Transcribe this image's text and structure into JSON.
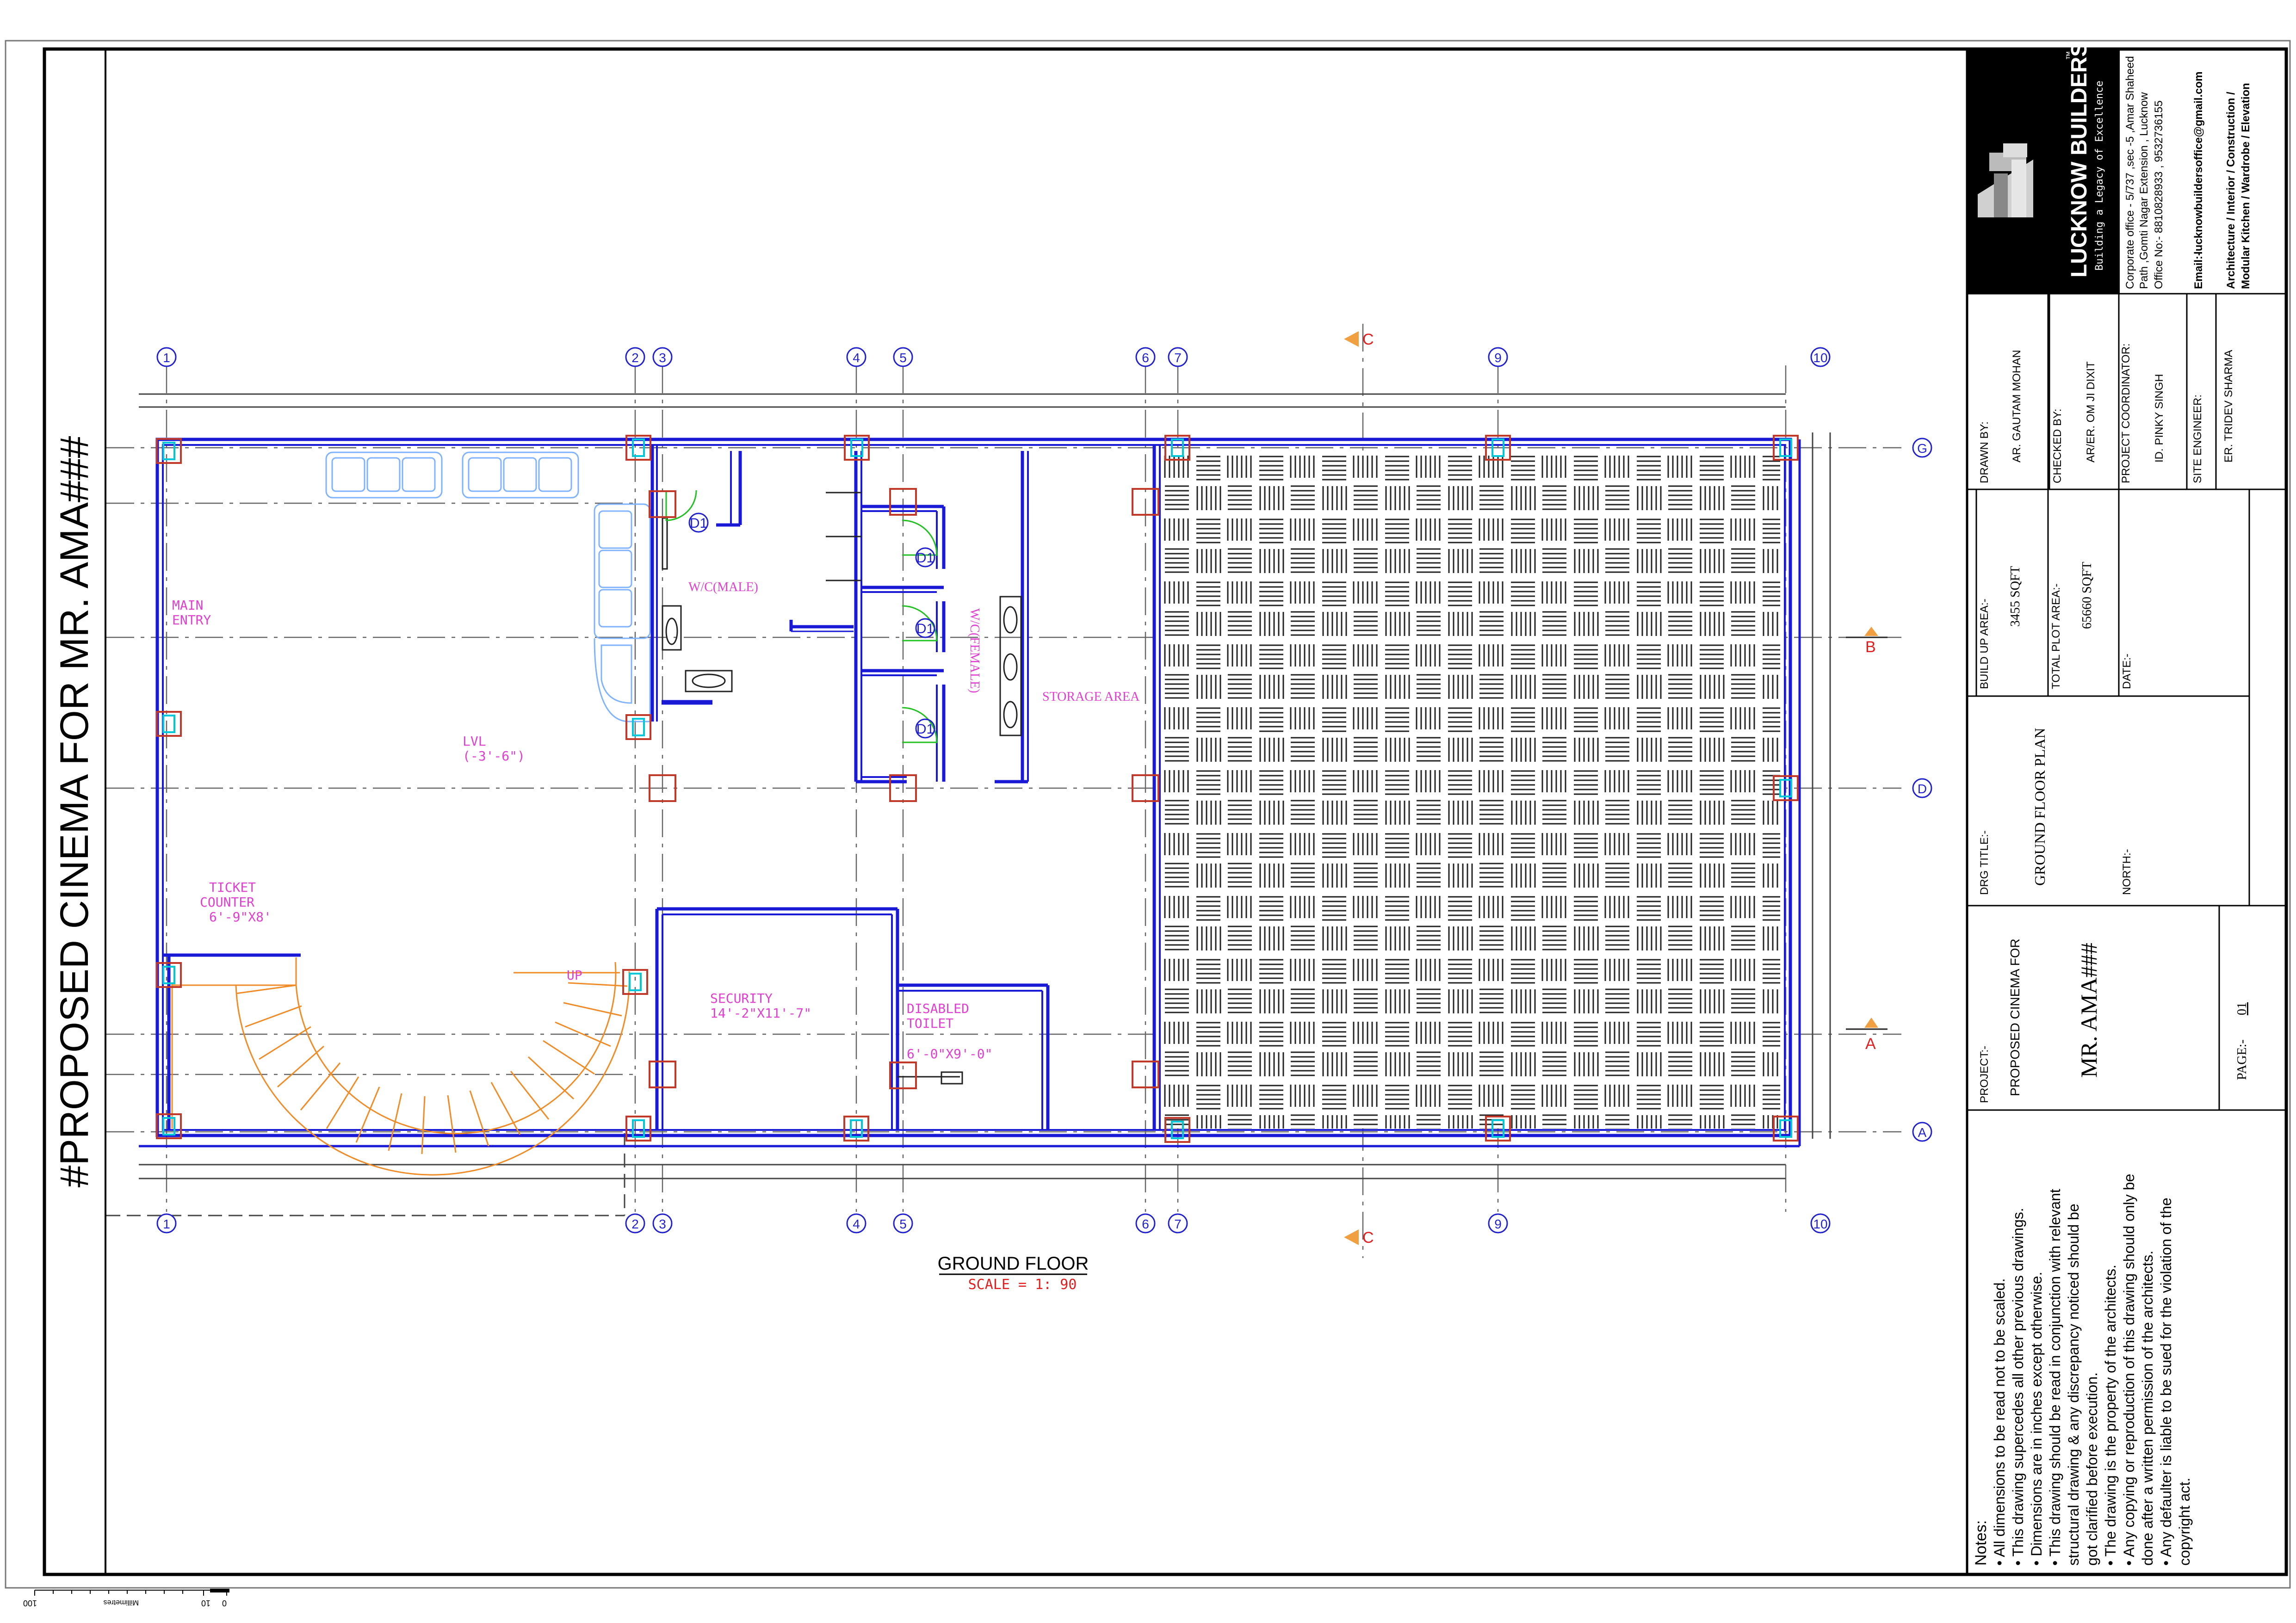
{
  "sheet_title": "#PROPOSED CINEMA FOR MR. AMA###",
  "drawing_title": {
    "name": "GROUND FLOOR",
    "scale": "SCALE   =  1: 90"
  },
  "grid": {
    "columns": [
      "1",
      "2",
      "3",
      "4",
      "5",
      "6",
      "7",
      "9",
      "10"
    ],
    "rows": [
      "G",
      "D",
      "A"
    ],
    "sections": [
      "C",
      "B",
      "A",
      "C"
    ]
  },
  "rooms": {
    "main_entry": "MAIN\nENTRY",
    "main_entry_line1": "MAIN",
    "main_entry_line2": "ENTRY",
    "lvl_line1": "LVL",
    "lvl_line2": "(-3'-6\")",
    "ticket_line1": "TICKET",
    "ticket_line2": "COUNTER",
    "ticket_line3": "6'-9\"X8'",
    "wc_male": "W/C(MALE)",
    "wc_female": "W/C(FEMALE)",
    "storage": "STORAGE AREA",
    "security_line1": "SECURITY",
    "security_line2": "14'-2\"X11'-7\"",
    "disabled_line1": "DISABLED",
    "disabled_line2": "TOILET",
    "disabled_line3": "6'-0\"X9'-0\"",
    "up": "UP",
    "door_tag": "D1"
  },
  "scale_bar": {
    "label": "Millimetres",
    "left": "100",
    "right_a": "0",
    "right_b": "10"
  },
  "notes": {
    "heading": "Notes:",
    "items": [
      "All dimensions to be read not to be scaled.",
      "This drawing supercedes all other previous drawings.",
      "Dimensions are in inches except otherwise.",
      "This drawing should be read in conjunction with relevant structural drawing & any discrepancy noticed should be got clarified before execution.",
      "The drawing is the property of the architects.",
      "Any copying or reproduction of this drawing should only be done after a written permission of the architects.",
      "Any defaulter is liable to be sued for the violation of the copyright act."
    ],
    "lines": [
      "• All dimensions to be read not to be scaled.",
      "• This drawing supercedes all other previous drawings.",
      "• Dimensions are in inches except otherwise.",
      "• This drawing should be read in conjunction with relevant",
      "   structural drawing & any discrepancy noticed should be",
      "   got clarified before execution.",
      "• The drawing is the property of the architects.",
      "• Any copying or reproduction of this drawing should only be",
      "   done after a written permission of the architects.",
      "• Any defaulter is liable to be sued for the violation of the",
      "   copyright act."
    ]
  },
  "title_block": {
    "project_label": "PROJECT:-",
    "project_value_1": "PROPOSED CINEMA FOR",
    "project_value_2": "MR. AMA###",
    "page_label": "PAGE:-",
    "page_value": "01",
    "drg_title_label": "DRG TITLE:-",
    "drg_title_value": "GROUND FLOOR PLAN",
    "north_label": "NORTH:-",
    "build_up_label": "BUILD UP AREA:-",
    "build_up_value": "3455 SQFT",
    "plot_area_label": "TOTAL PLOT AREA:-",
    "plot_area_value": "65660 SQFT",
    "date_label": "DATE:-",
    "drawn_by_label": "DRAWN BY:",
    "drawn_by_value": "AR. GAUTAM MOHAN",
    "checked_by_label": "CHECKED BY:",
    "checked_by_value": "AR/ER. OM JI DIXIT",
    "coordinator_label": "PROJECT COORDINATOR:",
    "coordinator_value": "ID. PINKY SINGH",
    "engineer_label": "SITE ENGINEER:",
    "engineer_value": "ER. TRIDEV SHARMA"
  },
  "company": {
    "name": "LUCKNOW BUILDERS",
    "tm": "™",
    "tagline": "Building a Legacy of Excellence",
    "address_1": "Corporate office - 5/737 ,sec -5 ,Amar Shaheed",
    "address_2": "Path ,Gomti Nagar Extension , Lucknow",
    "office": "Office No:- 8810828933 , 9532736155",
    "email_label": "Email:-",
    "email": "lucknowbuildersoffice@gmail.com",
    "services_1": "Architecture / Interior / Construction /",
    "services_2": "Modular Kitchen / Wardrobe / Elevation"
  },
  "colors": {
    "wall": "#1a1ad6",
    "column_outer": "#c0392b",
    "column_inner": "#00c8d8",
    "grid_bubble": "#2222cc",
    "annotation": "#e040d0",
    "stair": "#f08c28",
    "section_marker": "#f0a040",
    "section_text": "#e02020",
    "door": "#22c022"
  }
}
